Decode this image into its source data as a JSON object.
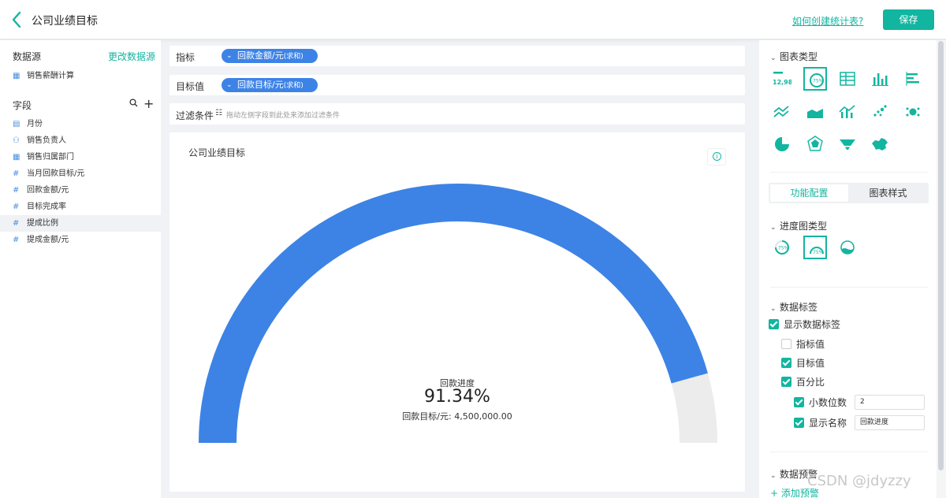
{
  "header": {
    "title": "公司业绩目标",
    "help_link": "如何创建统计表?",
    "save_label": "保存"
  },
  "left_panel": {
    "datasource_title": "数据源",
    "change_source": "更改数据源",
    "datasource": "销售薪酬计算",
    "fields_title": "字段",
    "fields": [
      {
        "icon": "calendar-icon",
        "glyph": "▤",
        "label": "月份"
      },
      {
        "icon": "person-icon",
        "glyph": "⚇",
        "label": "销售负责人"
      },
      {
        "icon": "department-icon",
        "glyph": "▦",
        "label": "销售归属部门"
      },
      {
        "icon": "number-icon",
        "glyph": "#",
        "label": "当月回款目标/元"
      },
      {
        "icon": "number-icon",
        "glyph": "#",
        "label": "回款金额/元"
      },
      {
        "icon": "number-icon",
        "glyph": "#",
        "label": "目标完成率"
      },
      {
        "icon": "number-icon",
        "glyph": "#",
        "label": "提成比例"
      },
      {
        "icon": "number-icon",
        "glyph": "#",
        "label": "提成金额/元"
      }
    ],
    "selected_field": "提成比例"
  },
  "config": {
    "indicator_label": "指标",
    "indicator_value": "回款金额/元",
    "indicator_agg": "(求和)",
    "target_label": "目标值",
    "target_value": "回款目标/元",
    "target_agg": "(求和)",
    "filter_label": "过滤条件",
    "filter_hint": "拖动左侧字段到此处来添加过滤条件"
  },
  "chart_data": {
    "type": "gauge",
    "title": "公司业绩目标",
    "series_name": "回款进度",
    "progress": 0.9134,
    "percent_label": "91.34%",
    "target_label": "回款目标/元:",
    "target_value": "4,500,000.00",
    "colors": {
      "fill": "#3d83e6",
      "track": "#ececec"
    }
  },
  "right_panel": {
    "chart_type_title": "图表类型",
    "chart_types": [
      "number-card-icon",
      "progress-chart-icon",
      "table-chart-icon",
      "bar-chart-icon",
      "horizontal-bar-chart-icon",
      "line-chart-icon",
      "area-chart-icon",
      "combo-chart-icon",
      "scatter-chart-icon",
      "bubble-chart-icon",
      "pie-chart-icon",
      "radar-chart-icon",
      "funnel-chart-icon",
      "map-chart-icon"
    ],
    "tab_function": "功能配置",
    "tab_style": "图表样式",
    "progress_type_title": "进度图类型",
    "progress_types": [
      "ring-progress-icon",
      "semicircle-progress-icon",
      "water-progress-icon"
    ],
    "data_label_title": "数据标签",
    "show_data_label": "显示数据标签",
    "opt_indicator": "指标值",
    "opt_target": "目标值",
    "opt_percent": "百分比",
    "opt_decimals": "小数位数",
    "decimals_value": "2",
    "opt_show_name": "显示名称",
    "name_value": "回款进度",
    "warning_title": "数据预警",
    "add_warning": "添加预警"
  },
  "watermark": "CSDN @jdyzzy",
  "accent_color": "#12b5a0"
}
